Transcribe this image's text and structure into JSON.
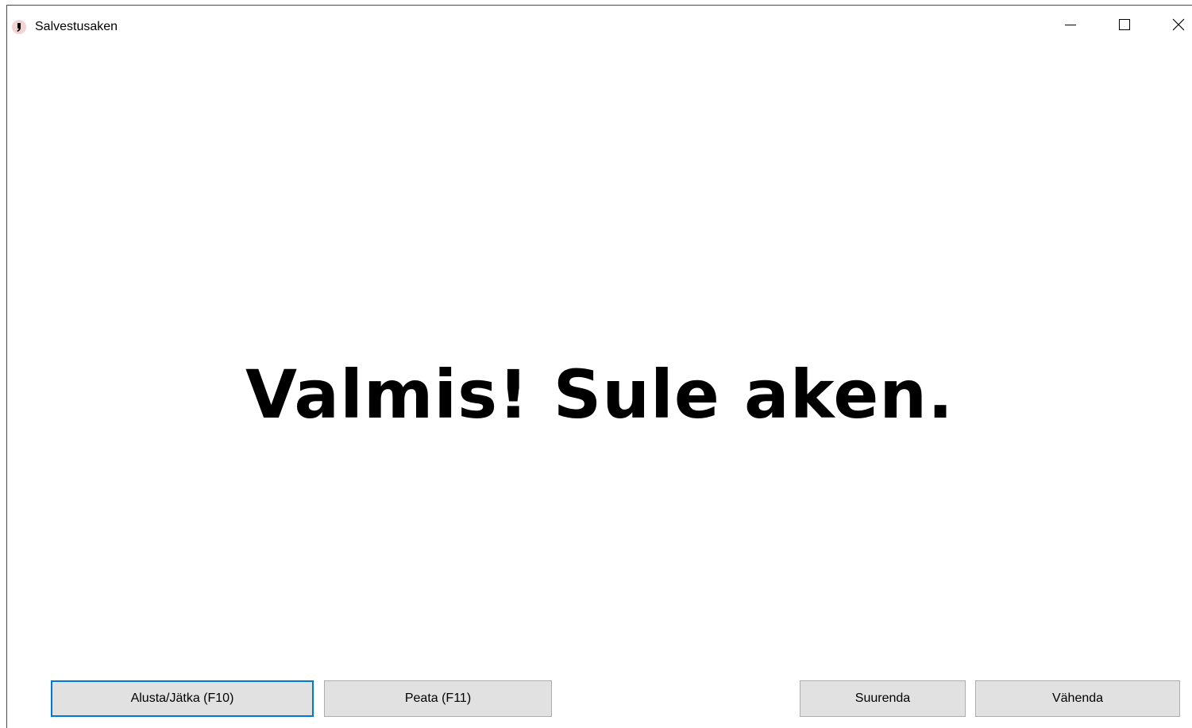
{
  "window": {
    "title": "Salvestusaken",
    "controls": {
      "minimize": "minimize",
      "maximize": "maximize",
      "close": "close"
    }
  },
  "main": {
    "message": "Valmis! Sule aken."
  },
  "buttons": {
    "start_continue": "Alusta/Jätka (F10)",
    "stop": "Peata (F11)",
    "enlarge": "Suurenda",
    "shrink": "Vähenda"
  },
  "colors": {
    "focus_border": "#0078d7",
    "button_bg": "#e1e1e1",
    "button_border": "#adadad",
    "icon_bg": "#f2d2d2"
  }
}
